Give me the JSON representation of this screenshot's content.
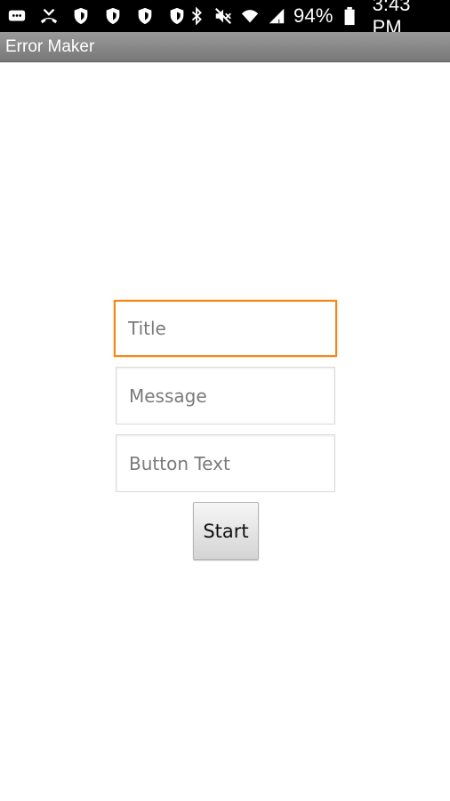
{
  "status_bar": {
    "left_icons": [
      "message-icon",
      "missed-call-icon",
      "shield-icon",
      "shield-icon",
      "shield-icon",
      "shield-icon"
    ],
    "right_icons": [
      "bluetooth-icon",
      "mute-icon",
      "wifi-icon",
      "signal-icon"
    ],
    "battery_percent": "94%",
    "time": "3:43 PM"
  },
  "app": {
    "title": "Error Maker"
  },
  "form": {
    "title_placeholder": "Title",
    "message_placeholder": "Message",
    "button_text_placeholder": "Button Text",
    "start_label": "Start"
  },
  "colors": {
    "focus_accent": "#f0891c",
    "title_bar": "#888888"
  }
}
